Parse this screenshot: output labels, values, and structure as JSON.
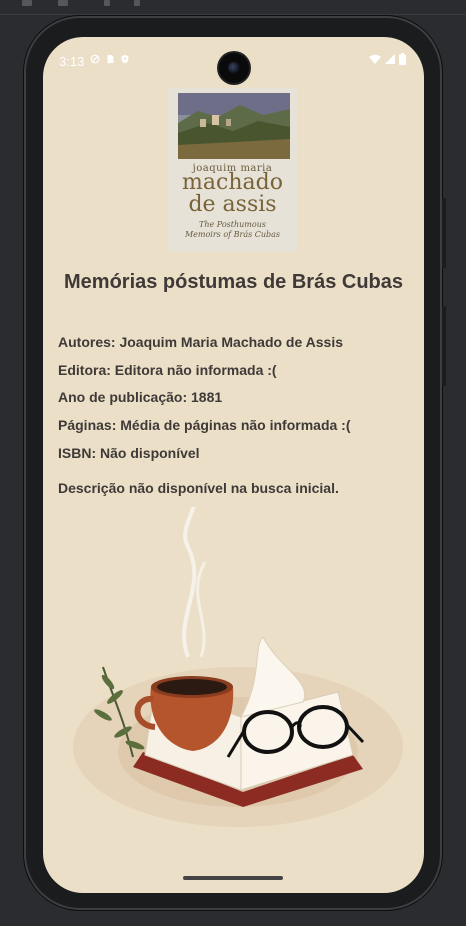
{
  "status_bar": {
    "time": "3:13"
  },
  "book": {
    "cover": {
      "author_small": "joaquim maria",
      "author_big_line1": "machado",
      "author_big_line2": "de assis",
      "subtitle": "The Posthumous Memoirs of Brás Cubas"
    },
    "title": "Memórias póstumas de Brás Cubas",
    "authors": "Autores: Joaquim Maria Machado de Assis",
    "publisher": "Editora: Editora não informada :(",
    "year": "Ano de publicação: 1881",
    "pages": "Páginas: Média de páginas não informada :(",
    "isbn": "ISBN: Não disponível",
    "description": "Descrição não disponível na busca inicial."
  },
  "colors": {
    "background": "#ebdfc8",
    "text": "#3f3a37"
  }
}
